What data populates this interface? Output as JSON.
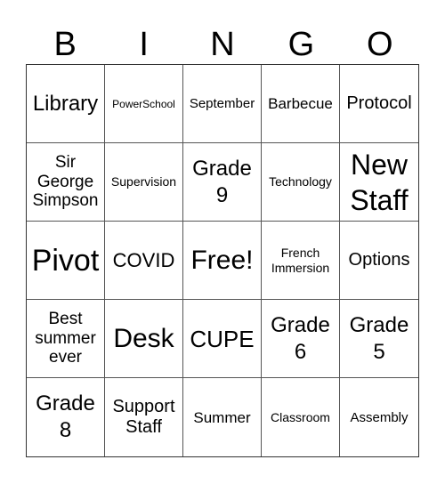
{
  "header": [
    "B",
    "I",
    "N",
    "G",
    "O"
  ],
  "cells": [
    "Library",
    "PowerSchool",
    "September",
    "Barbecue",
    "Protocol",
    "Sir George Simpson",
    "Supervision",
    "Grade 9",
    "Technology",
    "New Staff",
    "Pivot",
    "COVID",
    "Free!",
    "French Immersion",
    "Options",
    "Best summer ever",
    "Desk",
    "CUPE",
    "Grade 6",
    "Grade 5",
    "Grade 8",
    "Support Staff",
    "Summer",
    "Classroom",
    "Assembly"
  ]
}
